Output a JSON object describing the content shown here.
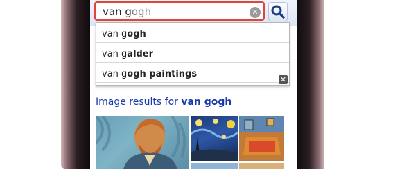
{
  "search": {
    "typed": "van g",
    "rest": "ogh"
  },
  "suggestions": [
    {
      "prefix": "van g",
      "bold": "ogh"
    },
    {
      "prefix": "van g",
      "bold": "alder"
    },
    {
      "prefix": "van g",
      "bold": "ogh paintings"
    }
  ],
  "results": {
    "heading_prefix": "Image results for ",
    "heading_query": "van gogh"
  },
  "icons": {
    "clear": "clear-icon",
    "search": "search-icon",
    "close": "close-icon"
  },
  "colors": {
    "input_border": "#e0443a",
    "link": "#1a3aa8"
  }
}
